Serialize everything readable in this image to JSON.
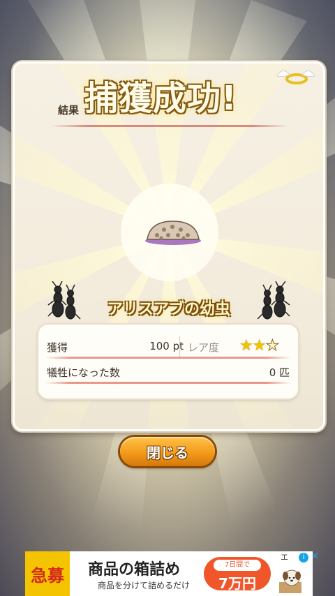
{
  "result": {
    "label": "結果",
    "title": "捕獲成功!",
    "insect_name": "アリスアブの幼虫"
  },
  "stats": {
    "obtained_label": "獲得",
    "obtained_value": "100 pt",
    "rarity_label": "レア度",
    "rarity_stars": 2,
    "rarity_max": 3,
    "victims_label": "犠牲になった数",
    "victims_value": "0 匹"
  },
  "buttons": {
    "close_label": "閉じる"
  },
  "ad": {
    "tag": "急募",
    "headline": "商品の箱詰め",
    "subtext": "商品を分けて詰めるだけ",
    "cta_top": "7日間で",
    "cta_main": "7万円",
    "choice_text": "エ"
  },
  "colors": {
    "button_orange": "#f39a1a",
    "title_gold": "#fbe27a",
    "star_gold": "#f3c300",
    "ad_yellow": "#f5c400",
    "ad_cta": "#f0562a"
  }
}
